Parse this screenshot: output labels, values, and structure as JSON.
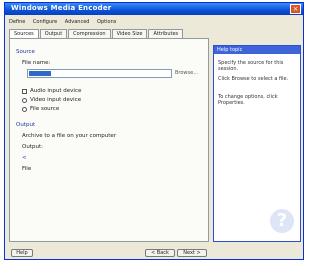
{
  "window": {
    "title": "Windows Media Encoder"
  },
  "top_tabs": [
    "Define",
    "Configure",
    "Advanced",
    "Options"
  ],
  "tabs": [
    "Sources",
    "Output",
    "Compression",
    "Video Size",
    "Attributes"
  ],
  "panel": {
    "group_source": "Source",
    "file_label": "File name:",
    "browse": "Browse...",
    "option_audio": "Audio input device",
    "option_video": "Video input device",
    "option_file": "File source",
    "group_output": "Output",
    "output_desc": "Archive to a file on your computer",
    "output_label": "Output:",
    "output_value": "<",
    "output_ok": "File"
  },
  "help": {
    "header": "Help topic",
    "p1": "Specify the source for this session.",
    "p2": "Click Browse to select a file.",
    "p3": "To change options, click Properties."
  },
  "buttons": {
    "help": "Help",
    "back": "< Back",
    "next": "Next >"
  }
}
